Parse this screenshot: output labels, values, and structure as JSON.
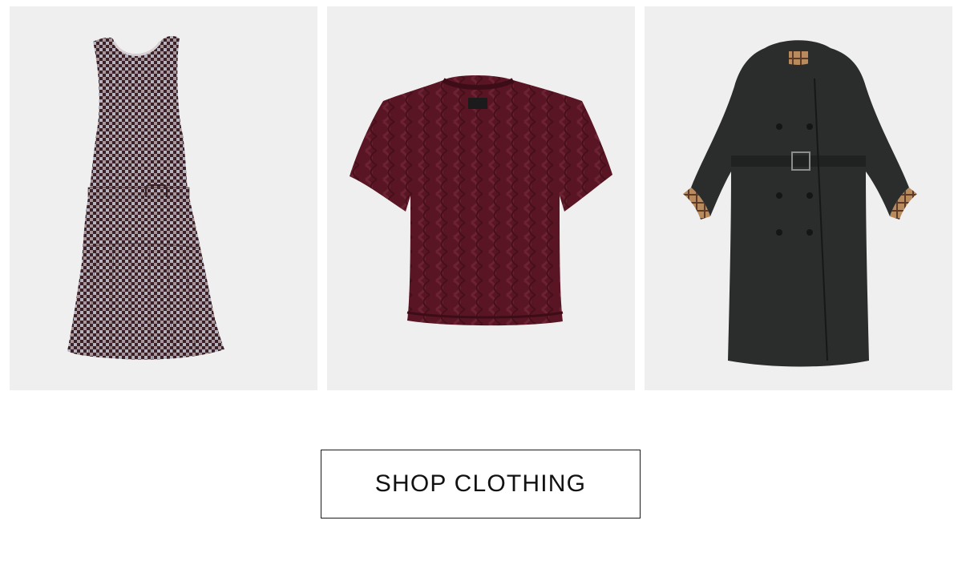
{
  "products": [
    {
      "item": "gingham-dress",
      "icon": "gingham-dress-image",
      "color": "#6e4a52"
    },
    {
      "item": "knit-sweater",
      "icon": "knit-sweater-image",
      "color": "#5a1525"
    },
    {
      "item": "trench-coat",
      "icon": "trench-coat-image",
      "color": "#2a2d2b"
    }
  ],
  "cta": {
    "label": "SHOP CLOTHING"
  },
  "colors": {
    "card_background": "#efefef",
    "page_background": "#ffffff",
    "button_border": "#1a1a1a",
    "button_text": "#111111"
  }
}
